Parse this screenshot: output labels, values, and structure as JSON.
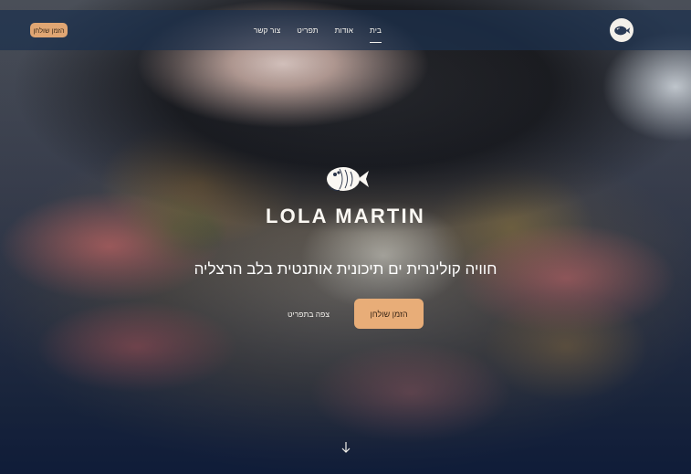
{
  "header": {
    "reserve_button": "הזמן שולחן",
    "nav": [
      {
        "label": "בית",
        "active": true
      },
      {
        "label": "אודות",
        "active": false
      },
      {
        "label": "תפריט",
        "active": false
      },
      {
        "label": "צור קשר",
        "active": false
      }
    ],
    "logo_icon": "flounder-fish-icon"
  },
  "hero": {
    "logo_icon": "flounder-fish-icon",
    "brand": "LOLA MARTIN",
    "tagline": "חוויה קולינרית ים תיכונית אותנטית בלב הרצליה",
    "primary_cta": "הזמן שולחן",
    "secondary_cta": "צפה בתפריט",
    "scroll_icon": "arrow-down-icon"
  },
  "colors": {
    "accent": "#e8ad78",
    "navbar": "#1c304e",
    "text": "#f3f1ec"
  }
}
